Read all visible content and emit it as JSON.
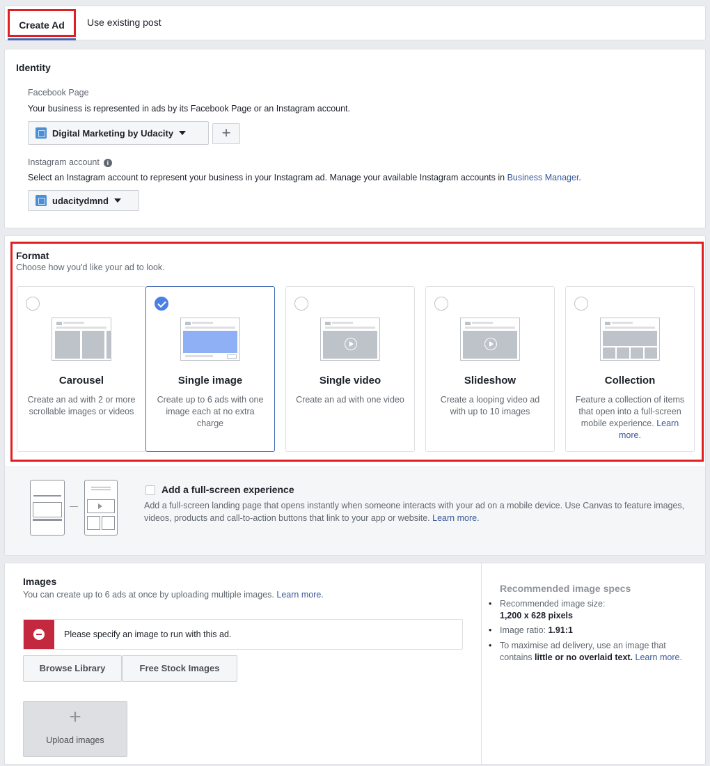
{
  "tabs": {
    "create_ad": "Create Ad",
    "use_existing": "Use existing post"
  },
  "identity": {
    "title": "Identity",
    "facebook_page_label": "Facebook Page",
    "facebook_page_desc": "Your business is represented in ads by its Facebook Page or an Instagram account.",
    "page_selected": "Digital Marketing by Udacity",
    "add_page_symbol": "+",
    "instagram_label": "Instagram account",
    "instagram_desc_prefix": "Select an Instagram account to represent your business in your Instagram ad. Manage your available Instagram accounts in ",
    "instagram_desc_link": "Business Manager",
    "instagram_desc_suffix": ".",
    "instagram_selected": "udacitydmnd"
  },
  "format": {
    "title": "Format",
    "subtitle": "Choose how you'd like your ad to look.",
    "options": [
      {
        "name": "Carousel",
        "desc": "Create an ad with 2 or more scrollable images or videos",
        "selected": false
      },
      {
        "name": "Single image",
        "desc": "Create up to 6 ads with one image each at no extra charge",
        "selected": true
      },
      {
        "name": "Single video",
        "desc": "Create an ad with one video",
        "selected": false
      },
      {
        "name": "Slideshow",
        "desc": "Create a looping video ad with up to 10 images",
        "selected": false
      },
      {
        "name": "Collection",
        "desc": "Feature a collection of items that open into a full-screen mobile experience.",
        "link": "Learn more.",
        "selected": false
      }
    ],
    "fullscreen": {
      "title": "Add a full-screen experience",
      "desc": "Add a full-screen landing page that opens instantly when someone interacts with your ad on a mobile device. Use Canvas to feature images, videos, products and call-to-action buttons that link to your app or website.",
      "link": "Learn more.",
      "checked": false
    }
  },
  "images": {
    "title": "Images",
    "subtitle": "You can create up to 6 ads at once by uploading multiple images.",
    "subtitle_link": "Learn more.",
    "error": "Please specify an image to run with this ad.",
    "browse_library": "Browse Library",
    "free_stock": "Free Stock Images",
    "upload": "Upload images",
    "upload_symbol": "+"
  },
  "specs": {
    "title": "Recommended image specs",
    "size_label": "Recommended image size:",
    "size_value": "1,200 x 628 pixels",
    "ratio_label": "Image ratio: ",
    "ratio_value": "1.91:1",
    "tip_prefix": "To maximise ad delivery, use an image that contains ",
    "tip_bold": "little or no overlaid text.",
    "tip_link": "Learn more."
  },
  "colors": {
    "accent": "#4267b2",
    "highlight": "#e02020",
    "error": "#c4283f",
    "link": "#385898"
  }
}
